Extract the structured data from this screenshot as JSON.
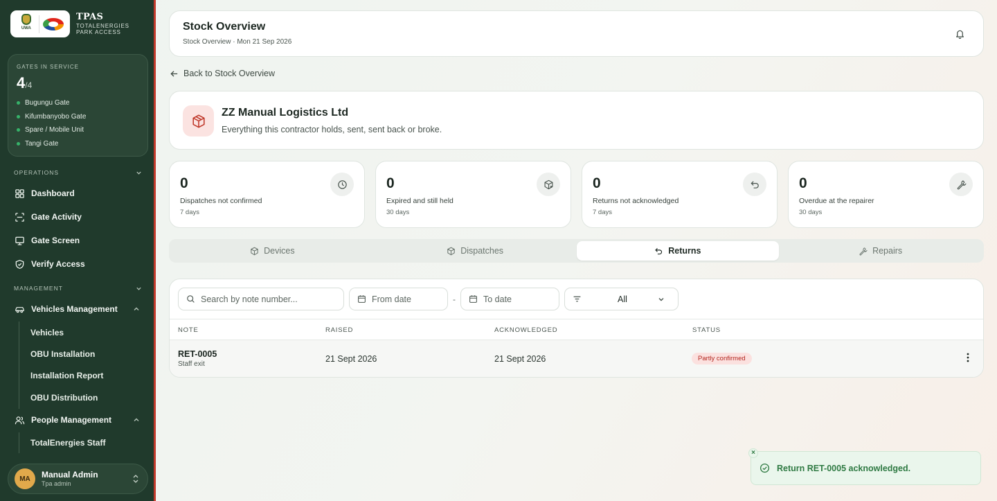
{
  "brand": {
    "logo_left_text": "UWA",
    "title": "TPAS",
    "subtitle_line1": "TOTALENERGIES",
    "subtitle_line2": "PARK ACCESS"
  },
  "gates": {
    "label": "GATES IN SERVICE",
    "count": "4",
    "total": "/4",
    "items": [
      "Bugungu Gate",
      "Kifumbanyobo Gate",
      "Spare / Mobile Unit",
      "Tangi Gate"
    ],
    "status_color": "#36b36a"
  },
  "sidebar": {
    "operations_label": "OPERATIONS",
    "operations": [
      "Dashboard",
      "Gate Activity",
      "Gate Screen",
      "Verify Access"
    ],
    "management_label": "MANAGEMENT",
    "vehicles_management": "Vehicles Management",
    "vehicles_sub": [
      "Vehicles",
      "OBU Installation",
      "Installation Report",
      "OBU Distribution"
    ],
    "people_management": "People Management",
    "people_sub": [
      "TotalEnergies Staff"
    ]
  },
  "user": {
    "initials": "MA",
    "name": "Manual Admin",
    "role": "Tpa admin"
  },
  "header": {
    "title": "Stock Overview",
    "breadcrumb": "Stock Overview · Mon 21 Sep 2026"
  },
  "back_link": "Back to Stock Overview",
  "contractor": {
    "name": "ZZ Manual Logistics Ltd",
    "description": "Everything this contractor holds, sent, sent back or broke."
  },
  "stats": [
    {
      "value": "0",
      "label": "Dispatches not confirmed",
      "sub": "7 days",
      "icon": "clock-icon"
    },
    {
      "value": "0",
      "label": "Expired and still held",
      "sub": "30 days",
      "icon": "package-x-icon"
    },
    {
      "value": "0",
      "label": "Returns not acknowledged",
      "sub": "7 days",
      "icon": "undo-icon"
    },
    {
      "value": "0",
      "label": "Overdue at the repairer",
      "sub": "30 days",
      "icon": "wrench-icon"
    }
  ],
  "tabs": [
    {
      "label": "Devices",
      "active": false
    },
    {
      "label": "Dispatches",
      "active": false
    },
    {
      "label": "Returns",
      "active": true
    },
    {
      "label": "Repairs",
      "active": false
    }
  ],
  "filters": {
    "search_placeholder": "Search by note number...",
    "from_date_placeholder": "From date",
    "separator": "-",
    "to_date_placeholder": "To date",
    "status_value": "All"
  },
  "table": {
    "headers": [
      "NOTE",
      "RAISED",
      "ACKNOWLEDGED",
      "STATUS"
    ],
    "rows": [
      {
        "note": "RET-0005",
        "note_sub": "Staff exit",
        "raised": "21 Sept 2026",
        "acknowledged": "21 Sept 2026",
        "status": "Partly confirmed",
        "status_color": "#b3261e"
      }
    ]
  },
  "toast": {
    "message": "Return RET-0005 acknowledged.",
    "close": "×"
  },
  "colors": {
    "sidebar": "#203a2c",
    "accent_red": "#c0392b",
    "success": "#2f7a43"
  }
}
